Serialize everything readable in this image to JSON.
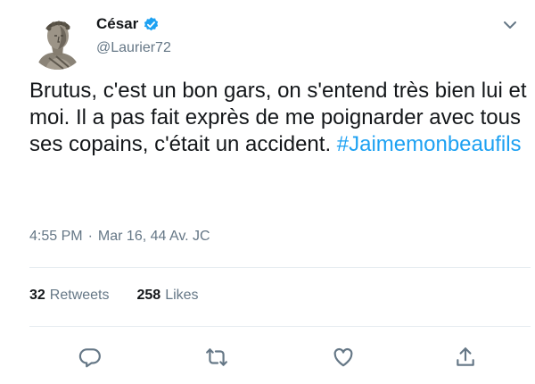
{
  "author": {
    "display_name": "César",
    "handle": "@Laurier72",
    "verified": true,
    "avatar_icon": "caesar-bust-avatar"
  },
  "tweet": {
    "text": "Brutus, c'est un bon gars, on s'entend très bien lui et moi. Il a pas fait exprès de me poignarder avec tous ses copains, c'était un accident.",
    "hashtag": "#Jaimemonbeaufils"
  },
  "timestamp": {
    "time": "4:55 PM",
    "separator": "·",
    "date": "Mar 16, 44 Av. JC"
  },
  "stats": {
    "retweets_count": "32",
    "retweets_label": "Retweets",
    "likes_count": "258",
    "likes_label": "Likes"
  },
  "actions": [
    {
      "icon": "reply-icon"
    },
    {
      "icon": "retweet-icon"
    },
    {
      "icon": "like-icon"
    },
    {
      "icon": "share-icon"
    }
  ],
  "colors": {
    "link": "#1da1f2",
    "secondary_text": "#657786",
    "primary_text": "#14171a",
    "divider": "#e6ecf0"
  }
}
